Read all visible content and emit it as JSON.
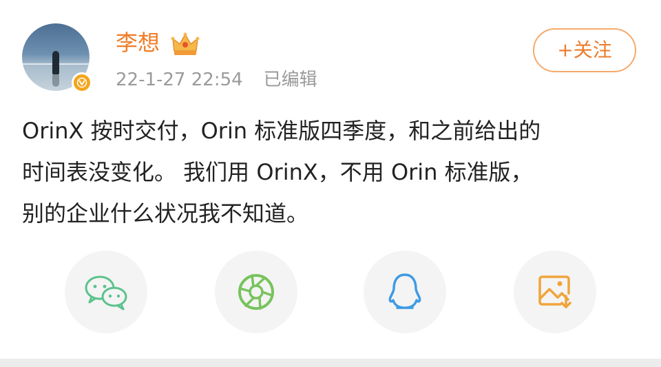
{
  "post": {
    "author": {
      "name": "李想",
      "badge_icon": "crown-badge-icon",
      "verified_icon": "verified-v-icon",
      "verified_color": "#f4a51c"
    },
    "timestamp": "22-1-27 22:54",
    "edited_label": "已编辑",
    "follow_label": "+关注",
    "content_lines": [
      "OrinX 按时交付，Orin 标准版四季度，和之前给出的",
      "时间表没变化。 我们用 OrinX，不用 Orin 标准版，",
      "别的企业什么状况我不知道。"
    ]
  },
  "share_buttons": [
    {
      "icon": "wechat-icon",
      "color": "#5bc28c"
    },
    {
      "icon": "moments-icon",
      "color": "#78c35c"
    },
    {
      "icon": "qq-icon",
      "color": "#3f9ae3"
    },
    {
      "icon": "save-image-icon",
      "color": "#f0a43a"
    }
  ],
  "colors": {
    "username": "#f07c26",
    "meta": "#9a9a9a",
    "follow_border": "#f5a96a",
    "text": "#222222",
    "share_bg": "#f4f4f4"
  }
}
